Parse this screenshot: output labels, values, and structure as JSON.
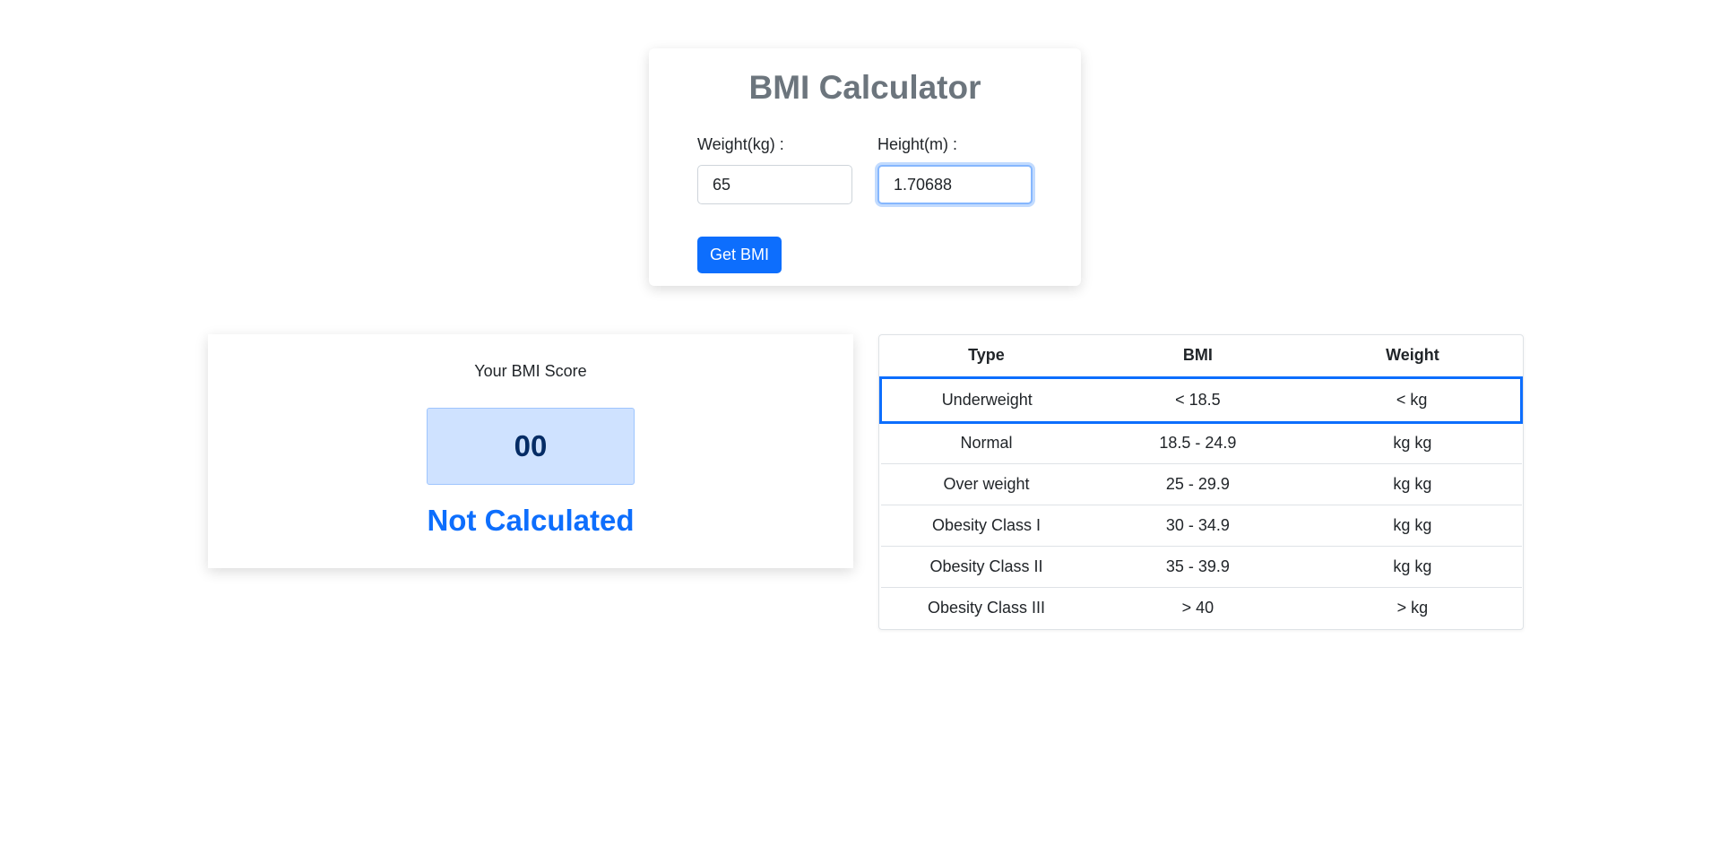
{
  "calculator": {
    "title": "BMI Calculator",
    "weight_label": "Weight(kg) :",
    "weight_value": "65",
    "height_label": "Height(m) :",
    "height_value": "1.70688",
    "button_label": "Get BMI"
  },
  "score": {
    "label": "Your BMI Score",
    "value": "00",
    "status": "Not Calculated"
  },
  "table": {
    "headers": [
      "Type",
      "BMI",
      "Weight"
    ],
    "rows": [
      {
        "type": "Underweight",
        "bmi": "< 18.5",
        "weight": "< kg"
      },
      {
        "type": "Normal",
        "bmi": "18.5 - 24.9",
        "weight": "kg kg"
      },
      {
        "type": "Over weight",
        "bmi": "25 - 29.9",
        "weight": "kg kg"
      },
      {
        "type": "Obesity Class I",
        "bmi": "30 - 34.9",
        "weight": "kg kg"
      },
      {
        "type": "Obesity Class II",
        "bmi": "35 - 39.9",
        "weight": "kg kg"
      },
      {
        "type": "Obesity Class III",
        "bmi": "> 40",
        "weight": "> kg"
      }
    ]
  },
  "colors": {
    "primary": "#0d6efd",
    "score_bg": "#cfe2ff",
    "score_text": "#052c65",
    "title_gray": "#6c757d"
  }
}
